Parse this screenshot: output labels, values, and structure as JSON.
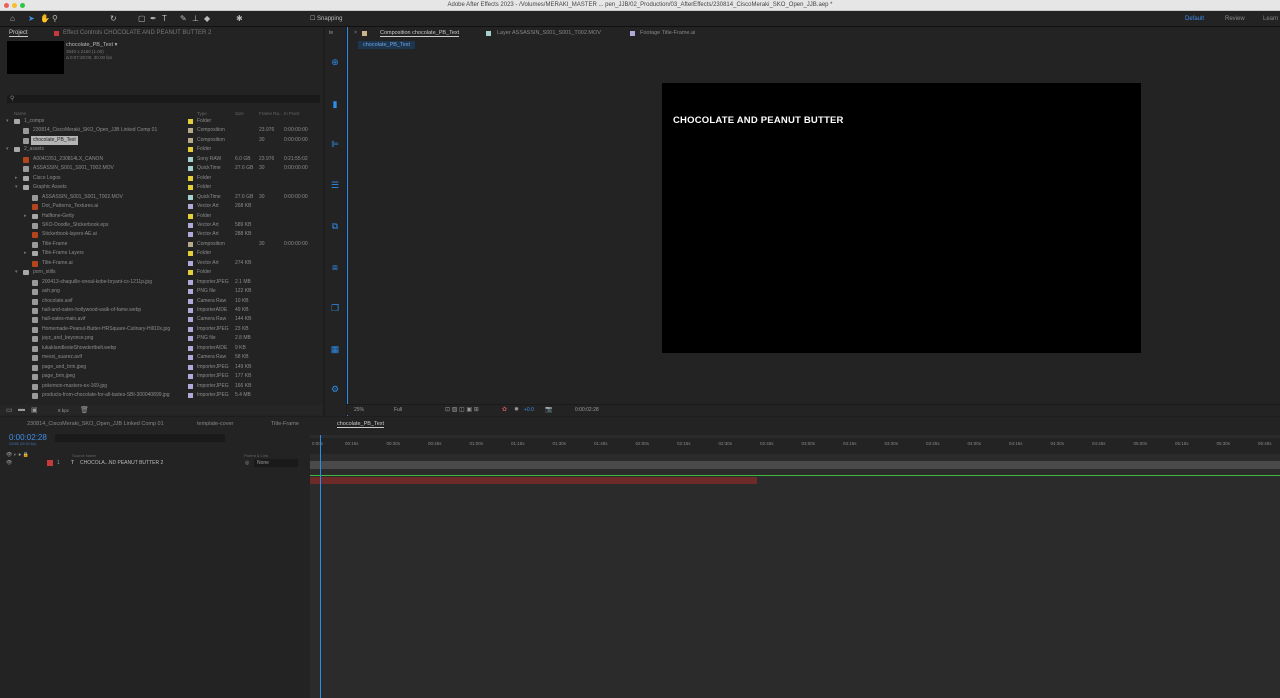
{
  "window": {
    "title": "Adobe After Effects 2023 - /Volumes/MERAKI_MASTER ... pen_JJB/02_Production/03_AfterEffects/230814_CiscoMeraki_SKO_Open_JJB.aep *"
  },
  "toolbar": {
    "snapping": "Snapping",
    "workspaces": [
      "Default",
      "Review",
      "Learn"
    ]
  },
  "project": {
    "tab": "Project",
    "effect_controls_tab": "Effect Controls CHOCOLATE AND PEANUT BUTTER 2",
    "preview": {
      "name": "chocolate_PB_Text ▾",
      "dims": "3840 x 2160 (1.00)",
      "duration": "Δ 0:07:30:00, 30.00 fps"
    },
    "columns": {
      "name": "Name",
      "type": "Type",
      "size": "Size",
      "frame_rate": "Frame Ra...",
      "in_point": "In Point"
    },
    "items": [
      {
        "name": "1_comps",
        "type": "Folder",
        "size": "",
        "fps": "",
        "in": "",
        "level": 0,
        "kind": "folder",
        "tw": "▾",
        "color": "#e3cf3a"
      },
      {
        "name": "230814_CiscoMeraki_SKO_Open_JJB Linked Comp 01",
        "type": "Composition",
        "size": "",
        "fps": "23.976",
        "in": "0:00:00:00",
        "level": 1,
        "kind": "comp",
        "tw": "",
        "color": "#b8a98a"
      },
      {
        "name": "chocolate_PB_Text",
        "type": "Composition",
        "size": "",
        "fps": "30",
        "in": "0:00:00:00",
        "level": 1,
        "kind": "comp",
        "tw": "",
        "color": "#b8a98a",
        "selected": true
      },
      {
        "name": "2_assets",
        "type": "Folder",
        "size": "",
        "fps": "",
        "in": "",
        "level": 0,
        "kind": "folder",
        "tw": "▾",
        "color": "#e3cf3a"
      },
      {
        "name": "A004C051_230814LX_CANON",
        "type": "Sony RAW",
        "size": "6.0 GB",
        "fps": "23.976",
        "in": "0:21:55:02",
        "level": 1,
        "kind": "ai",
        "tw": "",
        "color": "#a6d0cf"
      },
      {
        "name": "ASSASSIN_S001_S001_T002.MOV",
        "type": "QuickTime",
        "size": "27.6 GB",
        "fps": "30",
        "in": "0:00:00:00",
        "level": 1,
        "kind": "file",
        "tw": "",
        "color": "#a6d0cf"
      },
      {
        "name": "Cisco Logos",
        "type": "Folder",
        "size": "",
        "fps": "",
        "in": "",
        "level": 1,
        "kind": "folder",
        "tw": "▸",
        "color": "#e3cf3a"
      },
      {
        "name": "Graphic Assets",
        "type": "Folder",
        "size": "",
        "fps": "",
        "in": "",
        "level": 1,
        "kind": "folder",
        "tw": "▾",
        "color": "#e3cf3a"
      },
      {
        "name": "ASSASSIN_S001_S001_T002.MOV",
        "type": "QuickTime",
        "size": "27.6 GB",
        "fps": "30",
        "in": "0:00:00:00",
        "level": 2,
        "kind": "file",
        "tw": "",
        "color": "#a6d0cf"
      },
      {
        "name": "Dot_Patterns_Textures.ai",
        "type": "Vector Art",
        "size": "268 KB",
        "fps": "",
        "in": "",
        "level": 2,
        "kind": "ai",
        "tw": "",
        "color": "#b4a8d8"
      },
      {
        "name": "Halftone-Getty",
        "type": "Folder",
        "size": "",
        "fps": "",
        "in": "",
        "level": 2,
        "kind": "folder",
        "tw": "▸",
        "color": "#e3cf3a"
      },
      {
        "name": "SKO-Doodle_Stickerbook.eps",
        "type": "Vector Art",
        "size": "589 KB",
        "fps": "",
        "in": "",
        "level": 2,
        "kind": "file",
        "tw": "",
        "color": "#b4a8d8"
      },
      {
        "name": "Stickerbook-layers-AE.ai",
        "type": "Vector Art",
        "size": "288 KB",
        "fps": "",
        "in": "",
        "level": 2,
        "kind": "ai",
        "tw": "",
        "color": "#b4a8d8"
      },
      {
        "name": "Title-Frame",
        "type": "Composition",
        "size": "",
        "fps": "30",
        "in": "0:00:00:00",
        "level": 2,
        "kind": "comp",
        "tw": "",
        "color": "#b8a98a"
      },
      {
        "name": "Title-Frame Layers",
        "type": "Folder",
        "size": "",
        "fps": "",
        "in": "",
        "level": 2,
        "kind": "folder",
        "tw": "▸",
        "color": "#e3cf3a"
      },
      {
        "name": "Title-Frame.ai",
        "type": "Vector Art",
        "size": "274 KB",
        "fps": "",
        "in": "",
        "level": 2,
        "kind": "ai",
        "tw": "",
        "color": "#b4a8d8"
      },
      {
        "name": "porn_stills",
        "type": "Folder",
        "size": "",
        "fps": "",
        "in": "",
        "level": 1,
        "kind": "folder",
        "tw": "▾",
        "color": "#e3cf3a"
      },
      {
        "name": "200413-shaquille-oneal-kobe-bryant-cs-1211p.jpg",
        "type": "ImporterJPEG",
        "size": "2.1 MB",
        "fps": "",
        "in": "",
        "level": 2,
        "kind": "file",
        "tw": "",
        "color": "#b4a8d8"
      },
      {
        "name": "ash.png",
        "type": "PNG file",
        "size": "122 KB",
        "fps": "",
        "in": "",
        "level": 2,
        "kind": "file",
        "tw": "",
        "color": "#b4a8d8"
      },
      {
        "name": "chocolate.avif",
        "type": "Camera Raw",
        "size": "10 KB",
        "fps": "",
        "in": "",
        "level": 2,
        "kind": "file",
        "tw": "",
        "color": "#b4a8d8"
      },
      {
        "name": "hall-and-oates-hollywood-walk-of-fame.webp",
        "type": "ImporterAIDE",
        "size": "49 KB",
        "fps": "",
        "in": "",
        "level": 2,
        "kind": "file",
        "tw": "",
        "color": "#b4a8d8"
      },
      {
        "name": "hall-oates-main.avif",
        "type": "Camera Raw",
        "size": "144 KB",
        "fps": "",
        "in": "",
        "level": 2,
        "kind": "file",
        "tw": "",
        "color": "#b4a8d8"
      },
      {
        "name": "Homemade-Peanut-Butter-HRSquare-Culinary-Hill10x.jpg",
        "type": "ImporterJPEG",
        "size": "23 KB",
        "fps": "",
        "in": "",
        "level": 2,
        "kind": "file",
        "tw": "",
        "color": "#b4a8d8"
      },
      {
        "name": "jayz_and_beyonce.png",
        "type": "PNG file",
        "size": "2.8 MB",
        "fps": "",
        "in": "",
        "level": 2,
        "kind": "file",
        "tw": "",
        "color": "#b4a8d8"
      },
      {
        "name": "lukaklandlesteShowdertbelt.webp",
        "type": "ImporterAIDE",
        "size": "9 KB",
        "fps": "",
        "in": "",
        "level": 2,
        "kind": "file",
        "tw": "",
        "color": "#b4a8d8"
      },
      {
        "name": "messi_suarez.avif",
        "type": "Camera Raw",
        "size": "58 KB",
        "fps": "",
        "in": "",
        "level": 2,
        "kind": "file",
        "tw": "",
        "color": "#b4a8d8"
      },
      {
        "name": "page_and_brin.jpeg",
        "type": "ImporterJPEG",
        "size": "149 KB",
        "fps": "",
        "in": "",
        "level": 2,
        "kind": "file",
        "tw": "",
        "color": "#b4a8d8"
      },
      {
        "name": "page_brin.jpeg",
        "type": "ImporterJPEG",
        "size": "177 KB",
        "fps": "",
        "in": "",
        "level": 2,
        "kind": "file",
        "tw": "",
        "color": "#b4a8d8"
      },
      {
        "name": "pokemon-masters-ex-169.jpg",
        "type": "ImporterJPEG",
        "size": "166 KB",
        "fps": "",
        "in": "",
        "level": 2,
        "kind": "file",
        "tw": "",
        "color": "#b4a8d8"
      },
      {
        "name": "products-from-chocolate-for-all-tastes-SBI-300040899.jpg",
        "type": "ImporterJPEG",
        "size": "5.4 MB",
        "fps": "",
        "in": "",
        "level": 2,
        "kind": "file",
        "tw": "",
        "color": "#b4a8d8"
      }
    ],
    "footer_bpc": "8 bpc"
  },
  "composition": {
    "tabs": [
      "Composition chocolate_PB_Text",
      "Layer ASSASSIN_S001_S001_T002.MOV",
      "Footage Title-Frame.ai"
    ],
    "subtab": "chocolate_PB_Text",
    "viewer_text": "CHOCOLATE AND PEANUT BUTTER",
    "zoom": "25%",
    "resolution": "Full",
    "exposure": "+0.0",
    "timecode": "0:00:02:28"
  },
  "timeline": {
    "tabs": [
      "230814_CiscoMeraki_SKO_Open_JJB Linked Comp 01",
      "template-cover",
      "Title-Frame",
      "chocolate_PB_Text"
    ],
    "current_time": "0:00:02:28",
    "frames": "00088 (30.00 fps)",
    "columns": {
      "source_name": "Source Name",
      "parent": "Parent & Link"
    },
    "layer": {
      "index": "1",
      "name": "CHOCOLA...ND PEANUT BUTTER 2",
      "parent": "None",
      "color": "#c8393b"
    },
    "ruler": [
      "0:00s",
      "00:15s",
      "00:30s",
      "00:45s",
      "01:00s",
      "01:15s",
      "01:30s",
      "01:45s",
      "02:00s",
      "02:15s",
      "02:30s",
      "02:45s",
      "03:00s",
      "03:15s",
      "03:30s",
      "03:45s",
      "04:00s",
      "04:15s",
      "04:30s",
      "04:45s",
      "05:00s",
      "05:15s",
      "05:30s",
      "05:45s"
    ]
  }
}
